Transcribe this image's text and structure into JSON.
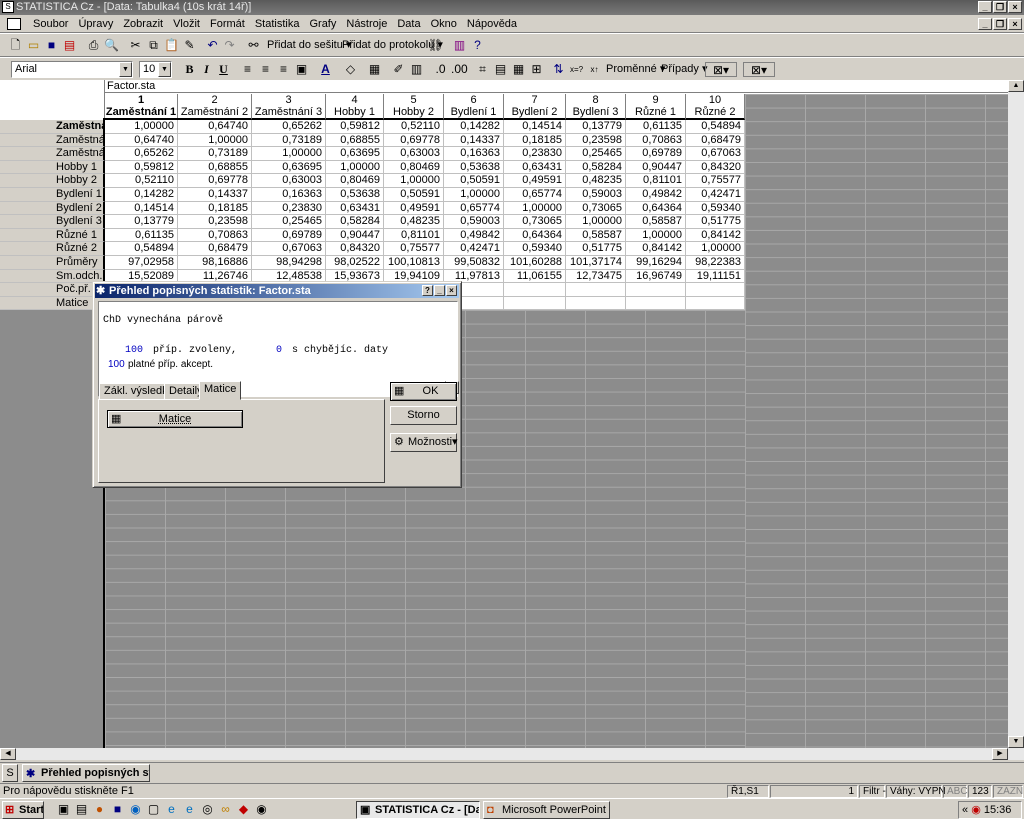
{
  "app": {
    "title": "STATISTICA Cz - [Data: Tabulka4 (10s krát 14ř)]"
  },
  "menu": [
    "Soubor",
    "Úpravy",
    "Zobrazit",
    "Vložit",
    "Formát",
    "Statistika",
    "Grafy",
    "Nástroje",
    "Data",
    "Okno",
    "Nápověda"
  ],
  "toolbar1": {
    "add_workbook": "Přidat do sešitu",
    "add_report": "Přidat do protokolu"
  },
  "toolbar2": {
    "font": "Arial",
    "size": "10",
    "bold": "B",
    "italic": "I",
    "underline": "U",
    "variables": "Proměnné",
    "cases": "Případy"
  },
  "sheet": {
    "file_name": "Factor.sta",
    "columns": [
      {
        "num": "1",
        "name": "Zaměstnání 1"
      },
      {
        "num": "2",
        "name": "Zaměstnání 2"
      },
      {
        "num": "3",
        "name": "Zaměstnání 3"
      },
      {
        "num": "4",
        "name": "Hobby 1"
      },
      {
        "num": "5",
        "name": "Hobby 2"
      },
      {
        "num": "6",
        "name": "Bydlení 1"
      },
      {
        "num": "7",
        "name": "Bydlení 2"
      },
      {
        "num": "8",
        "name": "Bydlení 3"
      },
      {
        "num": "9",
        "name": "Různé 1"
      },
      {
        "num": "10",
        "name": "Různé 2"
      }
    ],
    "rows": [
      {
        "label": "Zaměstná",
        "cells": [
          "1,00000",
          "0,64740",
          "0,65262",
          "0,59812",
          "0,52110",
          "0,14282",
          "0,14514",
          "0,13779",
          "0,61135",
          "0,54894"
        ]
      },
      {
        "label": "Zaměstná",
        "cells": [
          "0,64740",
          "1,00000",
          "0,73189",
          "0,68855",
          "0,69778",
          "0,14337",
          "0,18185",
          "0,23598",
          "0,70863",
          "0,68479"
        ]
      },
      {
        "label": "Zaměstná",
        "cells": [
          "0,65262",
          "0,73189",
          "1,00000",
          "0,63695",
          "0,63003",
          "0,16363",
          "0,23830",
          "0,25465",
          "0,69789",
          "0,67063"
        ]
      },
      {
        "label": "Hobby 1",
        "cells": [
          "0,59812",
          "0,68855",
          "0,63695",
          "1,00000",
          "0,80469",
          "0,53638",
          "0,63431",
          "0,58284",
          "0,90447",
          "0,84320"
        ]
      },
      {
        "label": "Hobby 2",
        "cells": [
          "0,52110",
          "0,69778",
          "0,63003",
          "0,80469",
          "1,00000",
          "0,50591",
          "0,49591",
          "0,48235",
          "0,81101",
          "0,75577"
        ]
      },
      {
        "label": "Bydlení 1",
        "cells": [
          "0,14282",
          "0,14337",
          "0,16363",
          "0,53638",
          "0,50591",
          "1,00000",
          "0,65774",
          "0,59003",
          "0,49842",
          "0,42471"
        ]
      },
      {
        "label": "Bydlení 2",
        "cells": [
          "0,14514",
          "0,18185",
          "0,23830",
          "0,63431",
          "0,49591",
          "0,65774",
          "1,00000",
          "0,73065",
          "0,64364",
          "0,59340"
        ]
      },
      {
        "label": "Bydlení 3",
        "cells": [
          "0,13779",
          "0,23598",
          "0,25465",
          "0,58284",
          "0,48235",
          "0,59003",
          "0,73065",
          "1,00000",
          "0,58587",
          "0,51775"
        ]
      },
      {
        "label": "Různé 1",
        "cells": [
          "0,61135",
          "0,70863",
          "0,69789",
          "0,90447",
          "0,81101",
          "0,49842",
          "0,64364",
          "0,58587",
          "1,00000",
          "0,84142"
        ]
      },
      {
        "label": "Různé 2",
        "cells": [
          "0,54894",
          "0,68479",
          "0,67063",
          "0,84320",
          "0,75577",
          "0,42471",
          "0,59340",
          "0,51775",
          "0,84142",
          "1,00000"
        ]
      },
      {
        "label": "Průměry",
        "cells": [
          "97,02958",
          "98,16886",
          "98,94298",
          "98,02522",
          "100,10813",
          "99,50832",
          "101,60288",
          "101,37174",
          "99,16294",
          "98,22383"
        ]
      },
      {
        "label": "Sm.odch.",
        "cells": [
          "15,52089",
          "11,26746",
          "12,48538",
          "15,93673",
          "19,94109",
          "11,97813",
          "11,06155",
          "12,73475",
          "16,96749",
          "19,11151"
        ]
      },
      {
        "label": "Poč.př.",
        "cells": [
          "",
          "",
          "",
          "",
          "",
          "",
          "",
          "",
          "",
          ""
        ]
      },
      {
        "label": "Matice",
        "cells": [
          "",
          "",
          "",
          "",
          "",
          "",
          "",
          "",
          "",
          ""
        ]
      }
    ]
  },
  "dialog": {
    "title": "Přehled popisných statistik: Factor.sta",
    "line1": "ChD vynechána párově",
    "n_selected": "100",
    "selected_text": "příp. zvoleny,",
    "n_missing": "0",
    "missing_text": "s chybějíc. daty",
    "n_valid": "100",
    "valid_text": "platné příp. akcept.",
    "tabs": [
      "Zákl. výsledky",
      "Detaily",
      "Matice"
    ],
    "matrix_button": "Matice",
    "ok": "OK",
    "cancel": "Storno",
    "options": "Možnosti"
  },
  "workspace_tab": "Přehled popisných st...",
  "status": {
    "help": "Pro nápovědu stiskněte F1",
    "cell": "Ř1,S1",
    "field1": "1",
    "filter": "Filtr -",
    "weights": "Váhy: VYPN",
    "abc": "ABC",
    "num": "123",
    "zaznam": "ZÁZN"
  },
  "taskbar": {
    "start": "Start",
    "task1": "STATISTICA Cz - [Dat...",
    "task2": "Microsoft PowerPoint - [...",
    "clock": "15:36"
  }
}
